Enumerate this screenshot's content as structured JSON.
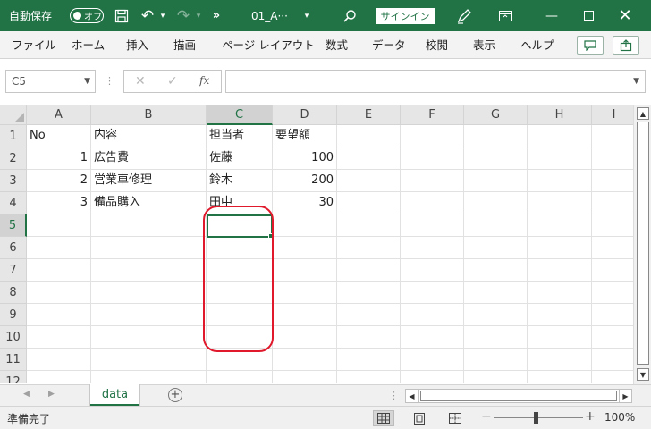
{
  "titlebar": {
    "autosave_label": "自動保存",
    "autosave_state": "オフ",
    "filename": "01_A···",
    "signin_label": "サインイン",
    "background": "#217346"
  },
  "menu": {
    "items": [
      "ファイル",
      "ホーム",
      "挿入",
      "描画",
      "ページ レイアウト",
      "数式",
      "データ",
      "校閲",
      "表示",
      "ヘルプ"
    ]
  },
  "formula_bar": {
    "name_box": "C5",
    "fx_label": "fx",
    "formula": ""
  },
  "sheet": {
    "columns": [
      "A",
      "B",
      "C",
      "D",
      "E",
      "F",
      "G",
      "H",
      "I"
    ],
    "selected_column": "C",
    "rows": [
      "1",
      "2",
      "3",
      "4",
      "5",
      "6",
      "7",
      "8",
      "9",
      "10",
      "11",
      "12"
    ],
    "selected_row": "5",
    "cells": {
      "A1": "No",
      "B1": "内容",
      "C1": "担当者",
      "D1": "要望額",
      "A2": "1",
      "B2": "広告費",
      "C2": "佐藤",
      "D2": "100",
      "A3": "2",
      "B3": "営業車修理",
      "C3": "鈴木",
      "D3": "200",
      "A4": "3",
      "B4": "備品購入",
      "C4": "田中",
      "D4": "30"
    },
    "active_cell": "C5",
    "highlight_color": "#e0192c",
    "accent_color": "#217346"
  },
  "tabs": {
    "sheets": [
      "data"
    ],
    "active": "data"
  },
  "status": {
    "text": "準備完了",
    "zoom": "100%"
  }
}
